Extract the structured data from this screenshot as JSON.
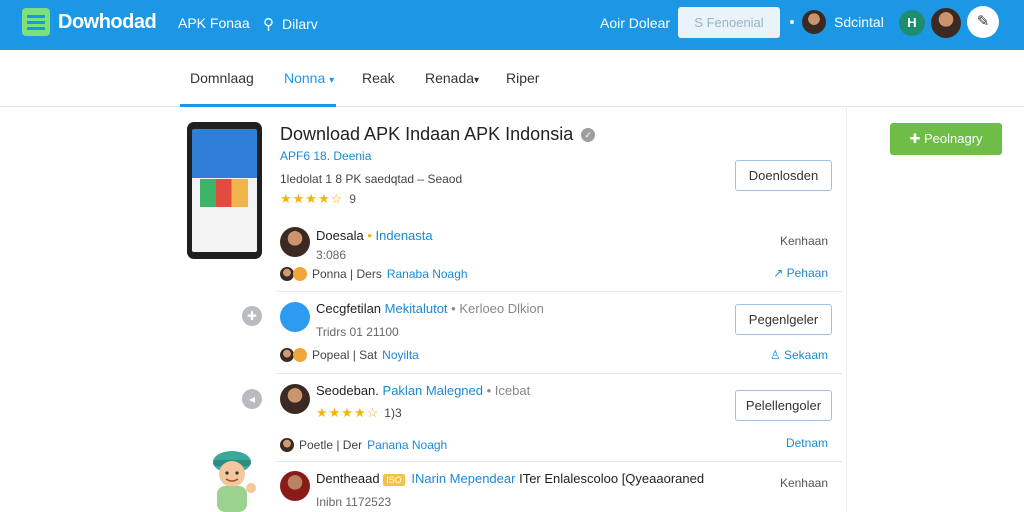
{
  "header": {
    "logo_text": "Dowhodad",
    "nav_apk": "APK Fonaa",
    "nav_search": "Dilarv",
    "nav_about": "Aoir Dolear",
    "search_placeholder": "S Fenoenial",
    "user_name": "Sdcintal",
    "badge_text": "H"
  },
  "tabs": [
    {
      "label": "Domnlaag"
    },
    {
      "label": "Nonna"
    },
    {
      "label": "Reak"
    },
    {
      "label": "Renada"
    },
    {
      "label": "Riper"
    }
  ],
  "app": {
    "title": "Download APK Indaan APK Indonsia",
    "meta": "APF6  18. Deenia",
    "subtitle": "1ledolat 1 8 PK saedqtad  –  Seaod",
    "rating_stars": "★★★★☆",
    "rating_count": "9",
    "download_button": "Doenlosden",
    "green_button": "Peolnagry"
  },
  "rows": [
    {
      "title": "Doesala",
      "title_sep": "•",
      "title_blue": "Indenasta",
      "date": "3:086",
      "foot_text": "Ponna | Ders",
      "foot_link": "Ranaba Noagh",
      "right_label": "Kenhaan",
      "right_link": "Pehaan"
    },
    {
      "title": "Cecgfetilan",
      "title_blue": "Mekitalutot",
      "title_gray": "• Kerloeo Dlkion",
      "date": "Tridrs 01 21100",
      "foot_text": "Popeal | Sat",
      "foot_link": "Noyilta",
      "button": "Pegenlgeler",
      "right_link": "Sekaam"
    },
    {
      "title": "Seodeban.",
      "title_blue": "Paklan Malegned",
      "title_gray": "• Icebat",
      "rating_stars": "★★★★☆",
      "rating_count": "1)3",
      "foot_text": "Poetle | Der",
      "foot_link": "Panana Noagh",
      "button": "Pelellengoler",
      "right_link": "Detnam"
    },
    {
      "title": "Dentheaad",
      "tag": "ISO",
      "title_blue": "INarin Mependear",
      "title_rest": "ITer Enlalescoloo [Qyeaaoraned",
      "date": "Inibn 1172523",
      "right_label": "Kenhaan"
    }
  ]
}
